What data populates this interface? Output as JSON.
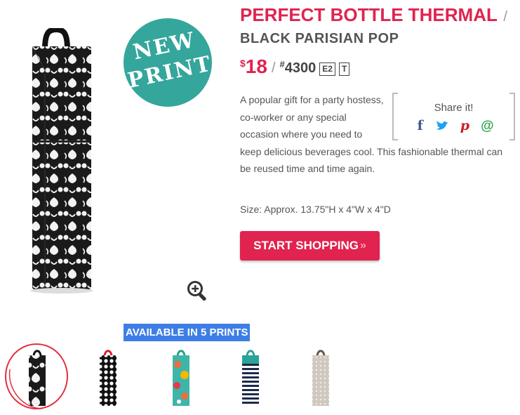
{
  "badge": {
    "line1": "NEW",
    "line2": "PRINT"
  },
  "product": {
    "title": "PERFECT BOTTLE THERMAL",
    "slash": "/",
    "print_name": "BLACK PARISIAN POP",
    "price_symbol": "$",
    "price": "18",
    "price_separator": "/",
    "item_hash": "#",
    "item_number": "4300",
    "codes": [
      "E2",
      "T"
    ],
    "description": "A popular gift for a party hostess, co-worker or any special occasion where you need to keep delicious beverages cool. This fashionable thermal can be reused time and time again.",
    "size": "Size: Approx. 13.75\"H x 4\"W x 4\"D"
  },
  "share": {
    "title": "Share it!",
    "icons": [
      {
        "name": "facebook-icon",
        "glyph": "f",
        "color": "#3b5998"
      },
      {
        "name": "twitter-icon",
        "glyph": "🐦",
        "color": "#1da1f2"
      },
      {
        "name": "pinterest-icon",
        "glyph": "p",
        "color": "#cb2027"
      },
      {
        "name": "email-icon",
        "glyph": "@",
        "color": "#32a852"
      }
    ]
  },
  "cta": {
    "label": "START SHOPPING",
    "chevron": "»"
  },
  "prints": {
    "available_label": "AVAILABLE IN 5 PRINTS",
    "items": [
      {
        "name": "Black Parisian Pop",
        "selected": true
      },
      {
        "name": "Black Dot with red handle",
        "selected": false
      },
      {
        "name": "Floral print",
        "selected": false
      },
      {
        "name": "Navy stripe",
        "selected": false
      },
      {
        "name": "Taupe pattern",
        "selected": false
      }
    ]
  },
  "colors": {
    "accent": "#e0234f",
    "badge": "#35a69b",
    "highlight": "#3d7ee6",
    "selected_circle": "#e03040"
  }
}
